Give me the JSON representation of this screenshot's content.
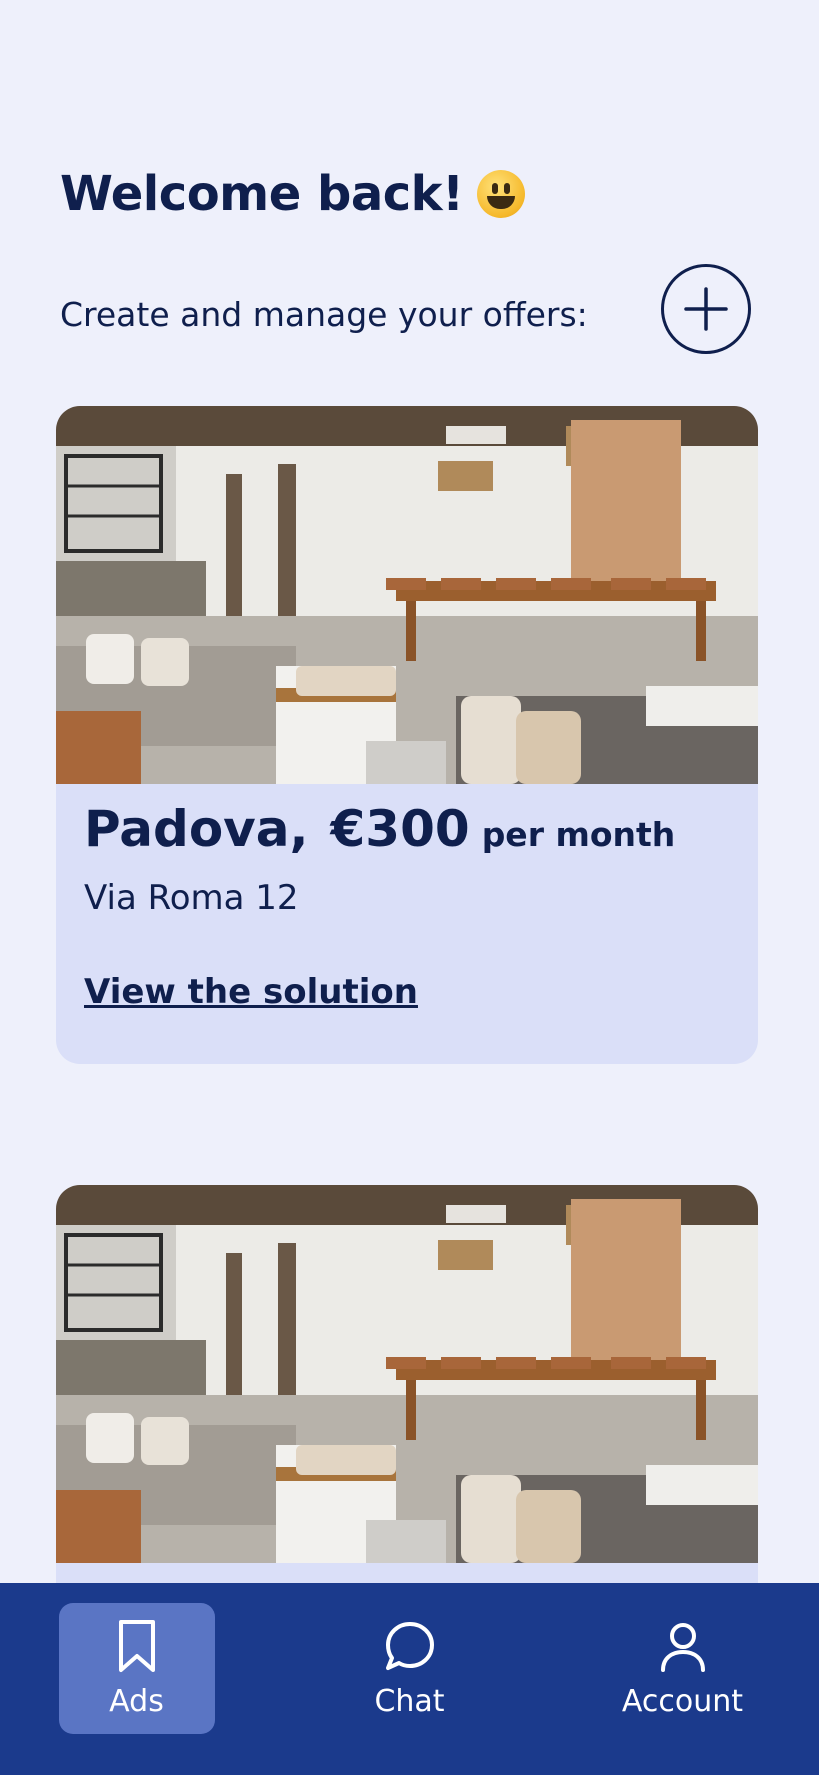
{
  "header": {
    "welcome": "Welcome back!",
    "emoji": "grinning-face-emoji",
    "subtitle": "Create and manage your offers:",
    "add_icon": "plus-circle-icon"
  },
  "listings": [
    {
      "city": "Padova,",
      "price": "€300",
      "period": "per month",
      "address": "Via Roma 12",
      "link_label": "View the solution",
      "image": "living-room-photo"
    },
    {
      "image": "living-room-photo"
    }
  ],
  "nav": {
    "items": [
      {
        "label": "Ads",
        "icon": "bookmark-icon",
        "active": true
      },
      {
        "label": "Chat",
        "icon": "chat-bubble-icon",
        "active": false
      },
      {
        "label": "Account",
        "icon": "user-icon",
        "active": false
      }
    ]
  },
  "colors": {
    "background": "#eef0fb",
    "text": "#0f1f4d",
    "card": "#dadff8",
    "nav_bg": "#1b3a8c",
    "nav_active": "#5a75c4"
  }
}
